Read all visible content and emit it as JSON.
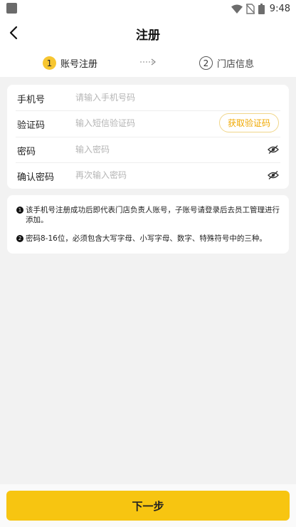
{
  "status_bar": {
    "time": "9:48",
    "icons": [
      "app-icon",
      "wifi-icon",
      "no-sim-icon",
      "battery-icon"
    ]
  },
  "header": {
    "title": "注册",
    "back_icon": "chevron-left-icon"
  },
  "steps": {
    "step1": {
      "number": "1",
      "label": "账号注册"
    },
    "step2": {
      "number": "2",
      "label": "门店信息"
    }
  },
  "form": {
    "phone": {
      "label": "手机号",
      "placeholder": "请输入手机号码",
      "value": ""
    },
    "code": {
      "label": "验证码",
      "placeholder": "输入短信验证码",
      "value": "",
      "button": "获取验证码"
    },
    "password": {
      "label": "密码",
      "placeholder": "输入密码",
      "value": "",
      "toggle_icon": "eye-off-icon"
    },
    "confirm": {
      "label": "确认密码",
      "placeholder": "再次输入密码",
      "value": "",
      "toggle_icon": "eye-off-icon"
    }
  },
  "notes": [
    {
      "number": "1",
      "text": "该手机号注册成功后即代表门店负责人账号，子账号请登录后去员工管理进行添加。"
    },
    {
      "number": "2",
      "text": "密码8-16位，必须包含大写字母、小写字母、数字、特殊符号中的三种。"
    }
  ],
  "footer": {
    "next_label": "下一步"
  },
  "colors": {
    "accent": "#f7c511",
    "accent_text": "#f0a800",
    "background": "#f2f2f2",
    "card": "#ffffff"
  }
}
